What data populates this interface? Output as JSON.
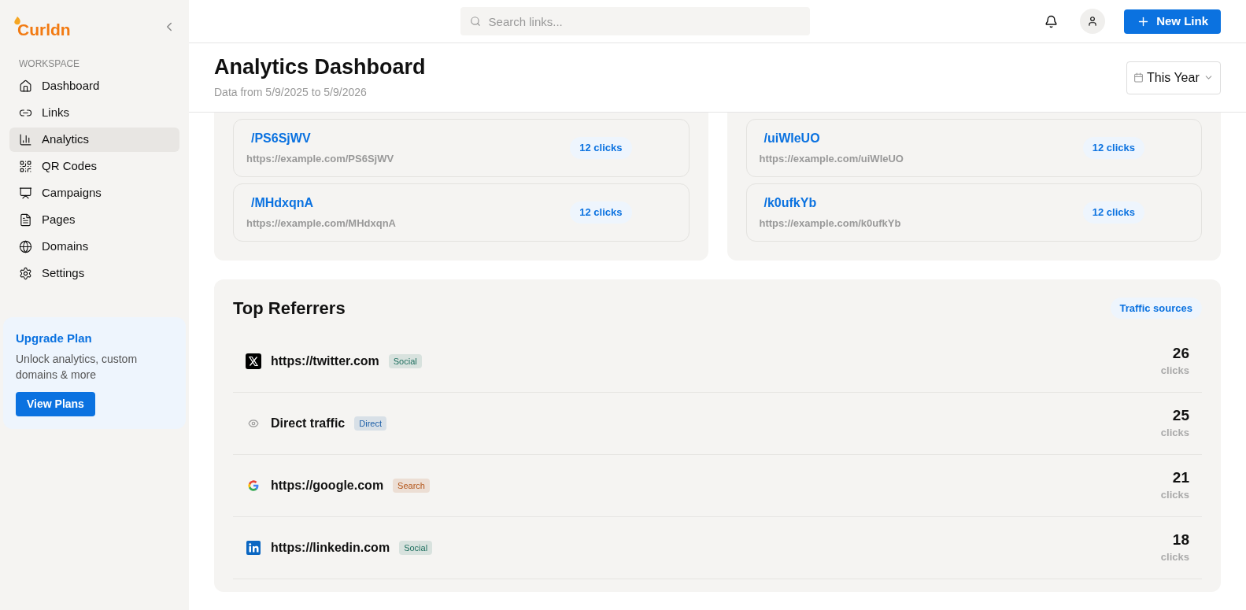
{
  "brand": {
    "name": "Curldn"
  },
  "sidebar": {
    "section": "WORKSPACE",
    "items": [
      {
        "label": "Dashboard",
        "selected": false
      },
      {
        "label": "Links",
        "selected": false
      },
      {
        "label": "Analytics",
        "selected": true
      },
      {
        "label": "QR Codes",
        "selected": false
      },
      {
        "label": "Campaigns",
        "selected": false
      },
      {
        "label": "Pages",
        "selected": false
      },
      {
        "label": "Domains",
        "selected": false
      },
      {
        "label": "Settings",
        "selected": false
      }
    ],
    "upgrade": {
      "title": "Upgrade Plan",
      "text": "Unlock analytics, custom domains & more",
      "button": "View Plans"
    }
  },
  "topbar": {
    "search": {
      "placeholder": "Search links..."
    },
    "new_button": "New Link"
  },
  "page": {
    "title": "Analytics Dashboard",
    "subtitle": "Data from 5/9/2025 to 5/9/2026",
    "range": "This Year"
  },
  "link_panels": [
    {
      "links": [
        {
          "slug": "/PS6SjWV",
          "url": "https://example.com/PS6SjWV",
          "clicks": "12 clicks"
        },
        {
          "slug": "/MHdxqnA",
          "url": "https://example.com/MHdxqnA",
          "clicks": "12 clicks"
        }
      ]
    },
    {
      "links": [
        {
          "slug": "/uiWIeUO",
          "url": "https://example.com/uiWIeUO",
          "clicks": "12 clicks"
        },
        {
          "slug": "/k0ufkYb",
          "url": "https://example.com/k0ufkYb",
          "clicks": "12 clicks"
        }
      ]
    }
  ],
  "referrers": {
    "title": "Top Referrers",
    "badge": "Traffic sources",
    "rows": [
      {
        "source": "https://twitter.com",
        "tag": "Social",
        "color": "#1f6f5f",
        "count": "26",
        "unit": "clicks"
      },
      {
        "source": "Direct traffic",
        "tag": "Direct",
        "color": "#1d5fa8",
        "count": "25",
        "unit": "clicks"
      },
      {
        "source": "https://google.com",
        "tag": "Search",
        "color": "#b35418",
        "count": "21",
        "unit": "clicks"
      },
      {
        "source": "https://linkedin.com",
        "tag": "Social",
        "color": "#1f6f5f",
        "count": "18",
        "unit": "clicks"
      }
    ]
  }
}
